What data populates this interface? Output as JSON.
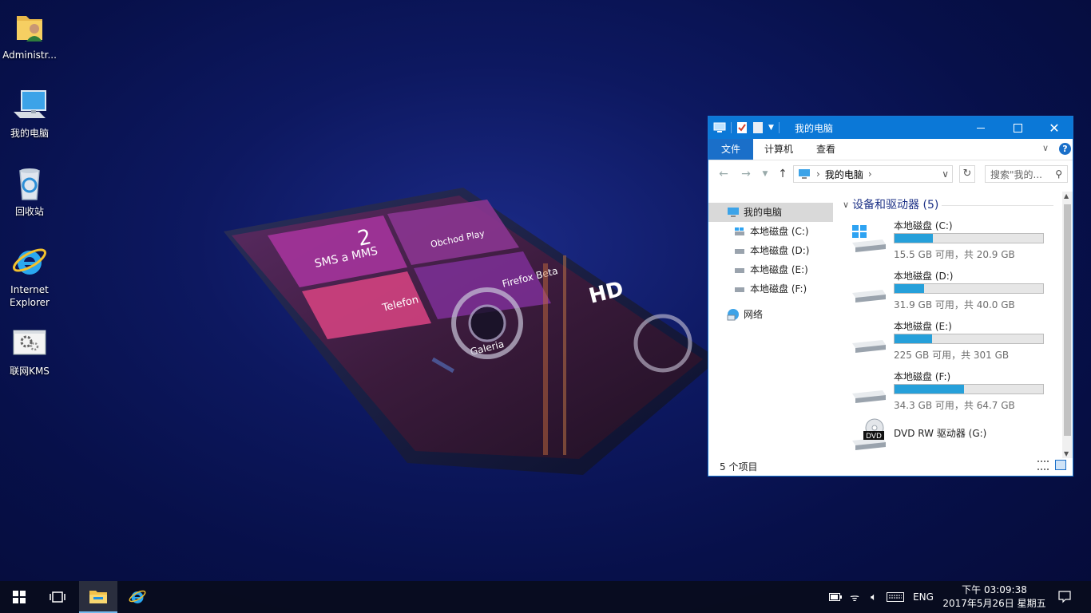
{
  "desktop": {
    "icons": [
      {
        "label": "Administr...",
        "icon": "user-folder-icon"
      },
      {
        "label": "我的电脑",
        "icon": "computer-icon"
      },
      {
        "label": "回收站",
        "icon": "recycle-bin-icon"
      },
      {
        "label": "Internet Explorer",
        "icon": "internet-explorer-icon"
      },
      {
        "label": "联网KMS",
        "icon": "kms-activator-icon"
      }
    ]
  },
  "explorer": {
    "title": "我的电脑",
    "ribbon_tabs": [
      "文件",
      "计算机",
      "查看"
    ],
    "address": {
      "path": "我的电脑"
    },
    "search": {
      "placeholder": "搜索\"我的..."
    },
    "nav_pane": {
      "items": [
        {
          "label": "我的电脑",
          "selected": true
        },
        {
          "label": "本地磁盘 (C:)"
        },
        {
          "label": "本地磁盘 (D:)"
        },
        {
          "label": "本地磁盘 (E:)"
        },
        {
          "label": "本地磁盘 (F:)"
        },
        {
          "label": "网络"
        }
      ]
    },
    "section": {
      "title": "设备和驱动器 (5)"
    },
    "drives": [
      {
        "name": "本地磁盘 (C:)",
        "info": "15.5 GB 可用，共 20.9 GB",
        "used_fraction": 0.26
      },
      {
        "name": "本地磁盘 (D:)",
        "info": "31.9 GB 可用，共 40.0 GB",
        "used_fraction": 0.2
      },
      {
        "name": "本地磁盘 (E:)",
        "info": "225 GB 可用，共 301 GB",
        "used_fraction": 0.25
      },
      {
        "name": "本地磁盘 (F:)",
        "info": "34.3 GB 可用，共 64.7 GB",
        "used_fraction": 0.47
      }
    ],
    "dvd": {
      "name": "DVD RW 驱动器 (G:)",
      "badge": "DVD"
    },
    "status": {
      "item_count": "5 个项目"
    },
    "colors": {
      "titlebar": "#0b78d7",
      "drive_bar_fill": "#26a0da",
      "section_header": "#1e3287"
    }
  },
  "taskbar": {
    "input_language": "ENG",
    "clock": {
      "time": "下午 03:09:38",
      "date": "2017年5月26日 星期五"
    }
  },
  "wallpaper": {
    "tiles": [
      "SMS a MMS",
      "2",
      "Obchod Play",
      "Telefon",
      "Firefox Beta",
      "HD",
      "Galeria"
    ]
  }
}
